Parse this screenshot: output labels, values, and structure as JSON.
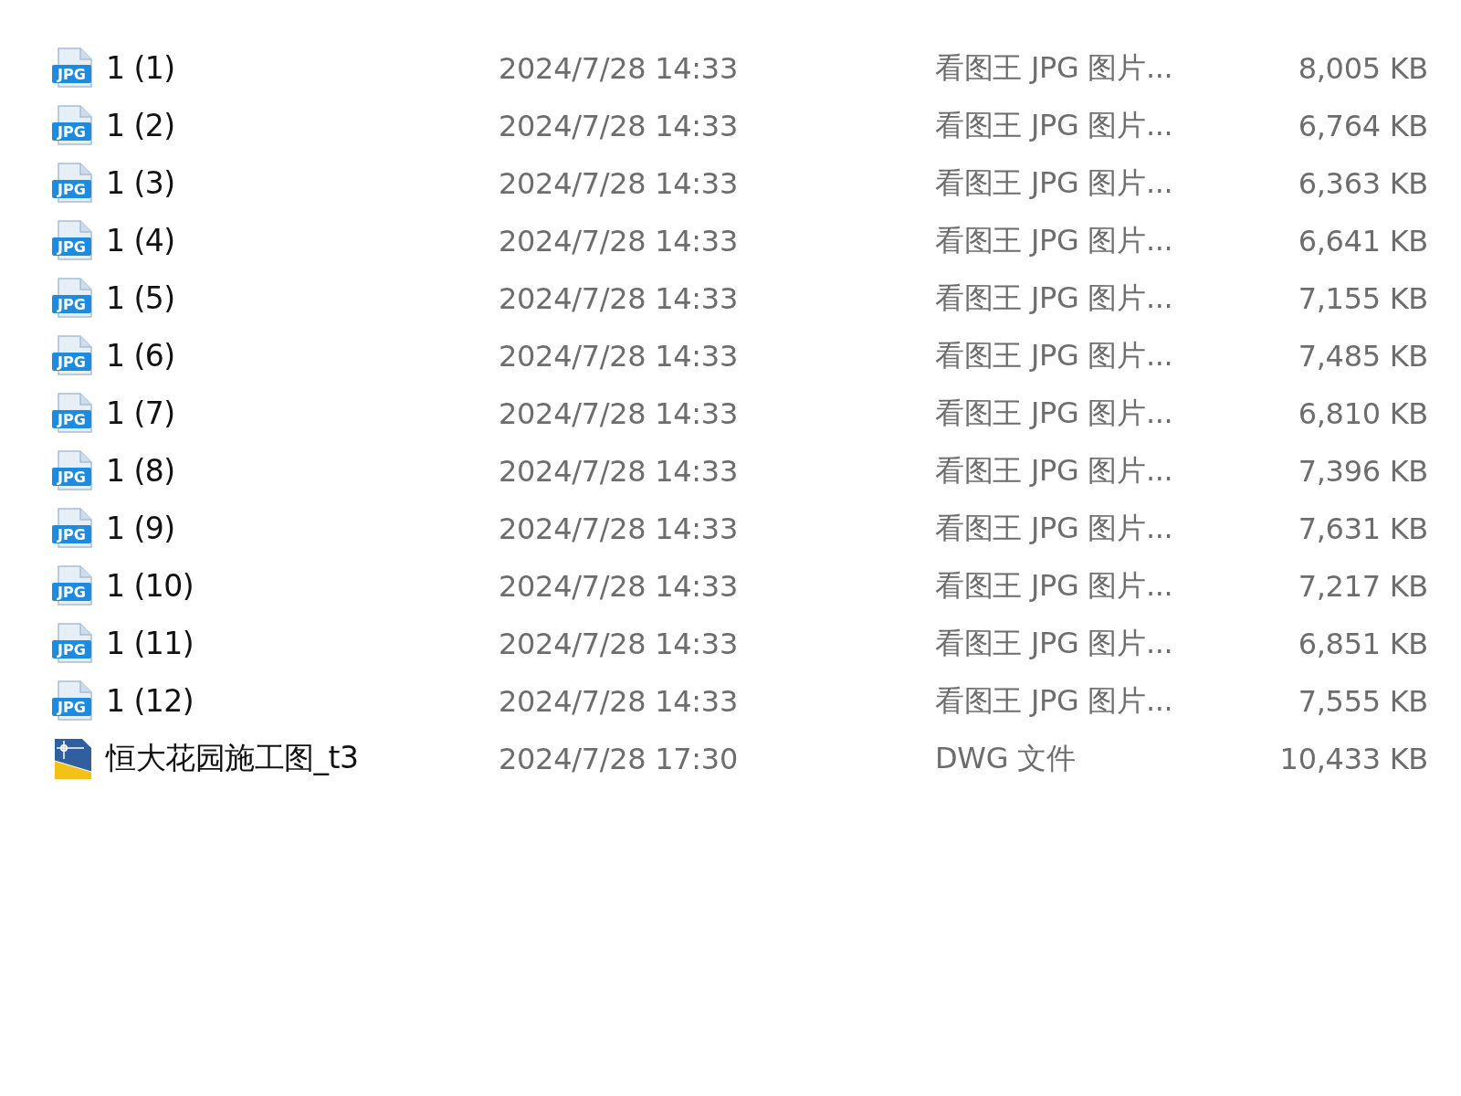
{
  "files": [
    {
      "kind": "jpg",
      "icon_text": "JPG",
      "name": "1 (1)",
      "date": "2024/7/28 14:33",
      "type": "看图王 JPG 图片...",
      "size": "8,005 KB"
    },
    {
      "kind": "jpg",
      "icon_text": "JPG",
      "name": "1 (2)",
      "date": "2024/7/28 14:33",
      "type": "看图王 JPG 图片...",
      "size": "6,764 KB"
    },
    {
      "kind": "jpg",
      "icon_text": "JPG",
      "name": "1 (3)",
      "date": "2024/7/28 14:33",
      "type": "看图王 JPG 图片...",
      "size": "6,363 KB"
    },
    {
      "kind": "jpg",
      "icon_text": "JPG",
      "name": "1 (4)",
      "date": "2024/7/28 14:33",
      "type": "看图王 JPG 图片...",
      "size": "6,641 KB"
    },
    {
      "kind": "jpg",
      "icon_text": "JPG",
      "name": "1 (5)",
      "date": "2024/7/28 14:33",
      "type": "看图王 JPG 图片...",
      "size": "7,155 KB"
    },
    {
      "kind": "jpg",
      "icon_text": "JPG",
      "name": "1 (6)",
      "date": "2024/7/28 14:33",
      "type": "看图王 JPG 图片...",
      "size": "7,485 KB"
    },
    {
      "kind": "jpg",
      "icon_text": "JPG",
      "name": "1 (7)",
      "date": "2024/7/28 14:33",
      "type": "看图王 JPG 图片...",
      "size": "6,810 KB"
    },
    {
      "kind": "jpg",
      "icon_text": "JPG",
      "name": "1 (8)",
      "date": "2024/7/28 14:33",
      "type": "看图王 JPG 图片...",
      "size": "7,396 KB"
    },
    {
      "kind": "jpg",
      "icon_text": "JPG",
      "name": "1 (9)",
      "date": "2024/7/28 14:33",
      "type": "看图王 JPG 图片...",
      "size": "7,631 KB"
    },
    {
      "kind": "jpg",
      "icon_text": "JPG",
      "name": "1 (10)",
      "date": "2024/7/28 14:33",
      "type": "看图王 JPG 图片...",
      "size": "7,217 KB"
    },
    {
      "kind": "jpg",
      "icon_text": "JPG",
      "name": "1 (11)",
      "date": "2024/7/28 14:33",
      "type": "看图王 JPG 图片...",
      "size": "6,851 KB"
    },
    {
      "kind": "jpg",
      "icon_text": "JPG",
      "name": "1 (12)",
      "date": "2024/7/28 14:33",
      "type": "看图王 JPG 图片...",
      "size": "7,555 KB"
    },
    {
      "kind": "dwg",
      "name": "恒大花园施工图_t3",
      "date": "2024/7/28 17:30",
      "type": "DWG 文件",
      "size": "10,433 KB"
    }
  ]
}
